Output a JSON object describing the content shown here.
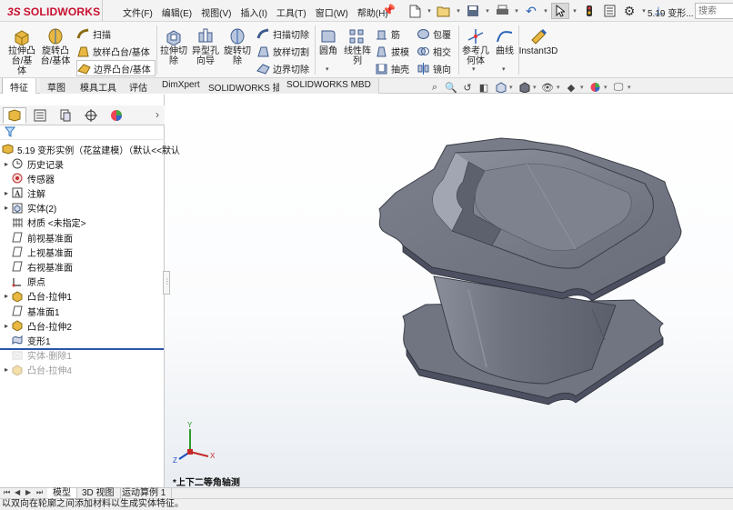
{
  "app": {
    "logo_ds": "3S",
    "logo_name": "SOLIDWORKS",
    "document_title": "5.19 变形...",
    "search_placeholder": "搜索"
  },
  "menu": [
    "文件(F)",
    "编辑(E)",
    "视图(V)",
    "插入(I)",
    "工具(T)",
    "窗口(W)",
    "帮助(H)"
  ],
  "quick_access_icons": [
    "new-document-icon",
    "open-icon",
    "save-icon",
    "print-icon",
    "undo-icon",
    "select-arrow-icon",
    "rebuild-icon",
    "file-properties-icon",
    "options-icon",
    "pushpin-icon"
  ],
  "ribbon": {
    "extruded_boss": "拉伸凸\n台/基体",
    "revolved_boss": "旋转凸\n台/基体",
    "sweep": "扫描",
    "loft_boss": "放样凸台/基体",
    "boundary_boss": "边界凸台/基体",
    "extruded_cut": "拉伸切\n除",
    "hole_wizard": "异型孔\n向导",
    "revolved_cut": "旋转切\n除",
    "swept_cut": "扫描切除",
    "lofted_cut": "放样切割",
    "boundary_cut": "边界切除",
    "fillet": "圆角",
    "linear_pattern": "线性阵\n列",
    "rib": "筋",
    "draft": "拔模",
    "shell": "抽壳",
    "wrap": "包覆",
    "intersect": "相交",
    "mirror": "镜向",
    "reference_geometry": "参考几\n何体",
    "curves": "曲线",
    "instant3d": "Instant3D"
  },
  "command_tabs": [
    "特征",
    "草图",
    "模具工具",
    "评估",
    "DimXpert",
    "SOLIDWORKS 插件",
    "SOLIDWORKS MBD"
  ],
  "feature_tree": {
    "root": "5.19 变形实例（花盆建模）（默认<<默认",
    "items": [
      {
        "label": "历史记录",
        "expand": "▸",
        "icon": "history-icon",
        "suppressed": false
      },
      {
        "label": "传感器",
        "expand": "",
        "icon": "sensor-icon",
        "suppressed": false
      },
      {
        "label": "注解",
        "expand": "▸",
        "icon": "annotations-icon",
        "suppressed": false
      },
      {
        "label": "实体(2)",
        "expand": "▸",
        "icon": "solid-bodies-icon",
        "suppressed": false
      },
      {
        "label": "材质 <未指定>",
        "expand": "",
        "icon": "material-icon",
        "suppressed": false
      },
      {
        "label": "前视基准面",
        "expand": "",
        "icon": "plane-icon",
        "suppressed": false
      },
      {
        "label": "上视基准面",
        "expand": "",
        "icon": "plane-icon",
        "suppressed": false
      },
      {
        "label": "右视基准面",
        "expand": "",
        "icon": "plane-icon",
        "suppressed": false
      },
      {
        "label": "原点",
        "expand": "",
        "icon": "origin-icon",
        "suppressed": false
      },
      {
        "label": "凸台-拉伸1",
        "expand": "▸",
        "icon": "boss-extrude-icon",
        "suppressed": false
      },
      {
        "label": "基准面1",
        "expand": "",
        "icon": "plane-icon",
        "suppressed": false
      },
      {
        "label": "凸台-拉伸2",
        "expand": "▸",
        "icon": "boss-extrude-icon",
        "suppressed": false
      },
      {
        "label": "变形1",
        "expand": "",
        "icon": "deform-icon",
        "suppressed": false
      },
      {
        "label": "实体-删除1",
        "expand": "",
        "icon": "delete-body-icon",
        "suppressed": true
      },
      {
        "label": "凸台-拉伸4",
        "expand": "▸",
        "icon": "boss-extrude-icon",
        "suppressed": true
      }
    ]
  },
  "graphics": {
    "view_label": "*上下二等角轴测",
    "triad": {
      "x": "X",
      "y": "Y",
      "z": "Z"
    }
  },
  "bottom_tabs": [
    "模型",
    "3D 视图",
    "运动算例 1"
  ],
  "status_text": "以双向在轮廓之间添加材料以生成实体特征。",
  "colors": {
    "model_fill": "#6f7380",
    "model_dark": "#4d5060",
    "model_light": "#9ea2ae",
    "brand_red": "#c8102e",
    "rollback_bar": "#2c55a8"
  }
}
